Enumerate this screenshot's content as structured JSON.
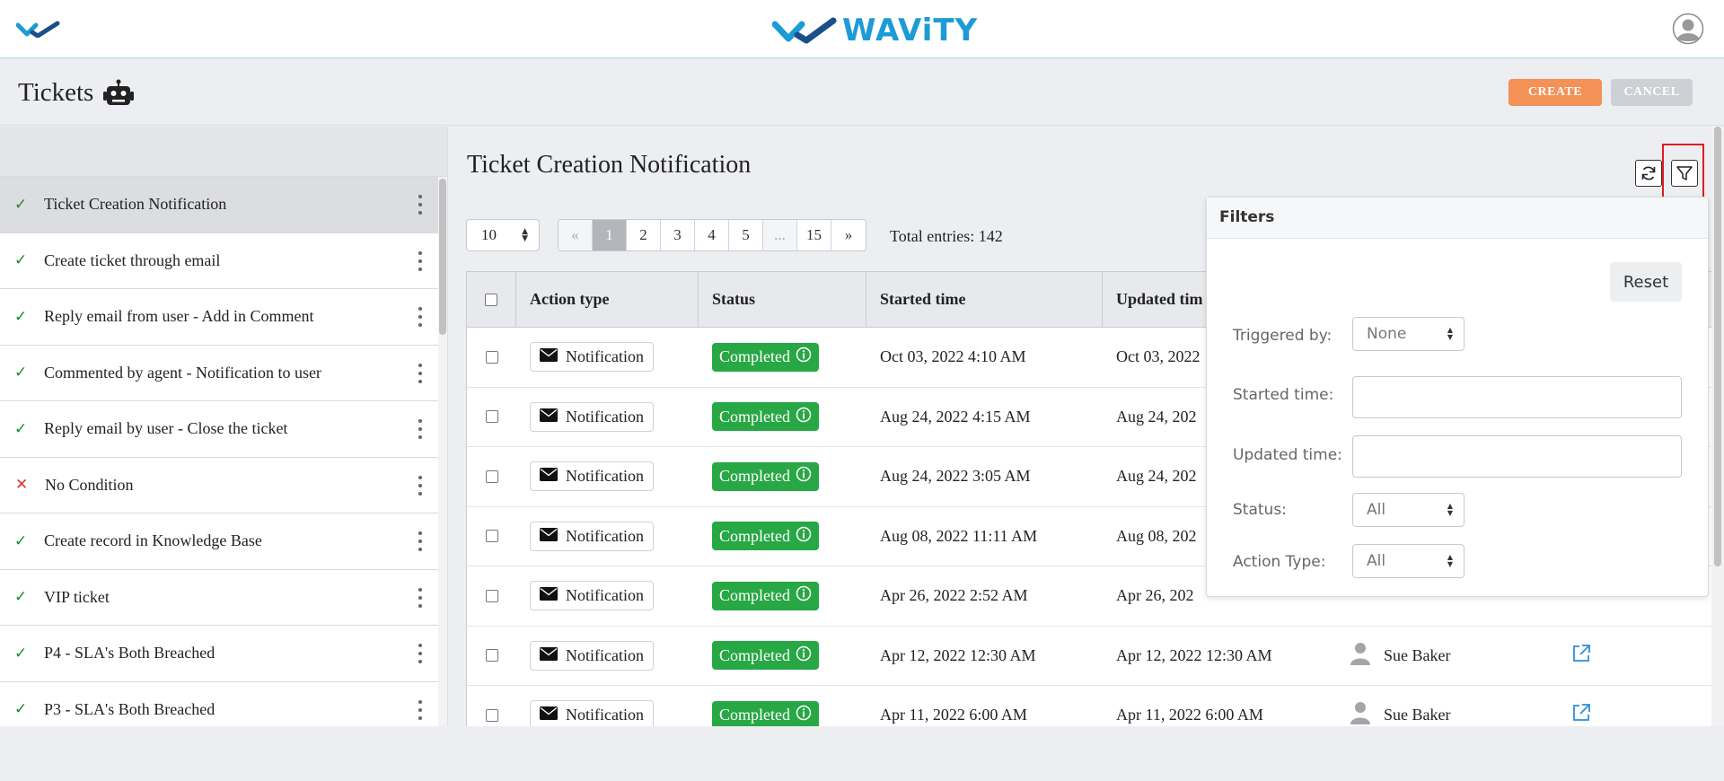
{
  "header": {
    "brand": "WAViTY"
  },
  "subheader": {
    "title": "Tickets",
    "create_label": "CREATE",
    "cancel_label": "CANCEL"
  },
  "sidebar": {
    "items": [
      {
        "label": "Ticket Creation Notification",
        "state": "check"
      },
      {
        "label": "Create ticket through email",
        "state": "check"
      },
      {
        "label": "Reply email from user - Add in Comment",
        "state": "check"
      },
      {
        "label": "Commented by agent - Notification to user",
        "state": "check"
      },
      {
        "label": "Reply email by user - Close the ticket",
        "state": "check"
      },
      {
        "label": "No Condition",
        "state": "cross"
      },
      {
        "label": "Create record in Knowledge Base",
        "state": "check"
      },
      {
        "label": "VIP ticket",
        "state": "check"
      },
      {
        "label": "P4 - SLA's Both Breached",
        "state": "check"
      },
      {
        "label": "P3 - SLA's Both Breached",
        "state": "check"
      }
    ],
    "check_glyph": "✓",
    "cross_glyph": "✕"
  },
  "main": {
    "title": "Ticket Creation Notification",
    "page_size": "10",
    "pager": {
      "prev": "«",
      "pages": [
        "1",
        "2",
        "3",
        "4",
        "5",
        "...",
        "15"
      ],
      "next": "»",
      "current": "1"
    },
    "total": "Total entries: 142"
  },
  "table": {
    "headers": {
      "action_type": "Action type",
      "status": "Status",
      "started": "Started time",
      "updated": "Updated tim"
    },
    "rows": [
      {
        "action": "Notification",
        "status": "Completed",
        "started": "Oct 03, 2022 4:10 AM",
        "updated": "Oct 03, 2022",
        "user": ""
      },
      {
        "action": "Notification",
        "status": "Completed",
        "started": "Aug 24, 2022 4:15 AM",
        "updated": "Aug 24, 202",
        "user": ""
      },
      {
        "action": "Notification",
        "status": "Completed",
        "started": "Aug 24, 2022 3:05 AM",
        "updated": "Aug 24, 202",
        "user": ""
      },
      {
        "action": "Notification",
        "status": "Completed",
        "started": "Aug 08, 2022 11:11 AM",
        "updated": "Aug 08, 202",
        "user": ""
      },
      {
        "action": "Notification",
        "status": "Completed",
        "started": "Apr 26, 2022 2:52 AM",
        "updated": "Apr 26, 202",
        "user": ""
      },
      {
        "action": "Notification",
        "status": "Completed",
        "started": "Apr 12, 2022 12:30 AM",
        "updated": "Apr 12, 2022 12:30 AM",
        "user": "Sue Baker"
      },
      {
        "action": "Notification",
        "status": "Completed",
        "started": "Apr 11, 2022 6:00 AM",
        "updated": "Apr 11, 2022 6:00 AM",
        "user": "Sue Baker"
      }
    ]
  },
  "filters": {
    "title": "Filters",
    "reset_label": "Reset",
    "triggered_by_label": "Triggered by:",
    "triggered_by_value": "None",
    "started_label": "Started time:",
    "started_value": "",
    "updated_label": "Updated time:",
    "updated_value": "",
    "status_label": "Status:",
    "status_value": "All",
    "action_type_label": "Action Type:",
    "action_type_value": "All"
  },
  "colors": {
    "brand_blue": "#1d9bd7",
    "create_orange": "#f39156",
    "completed_green": "#28a745",
    "highlight_red": "#e01b22"
  }
}
